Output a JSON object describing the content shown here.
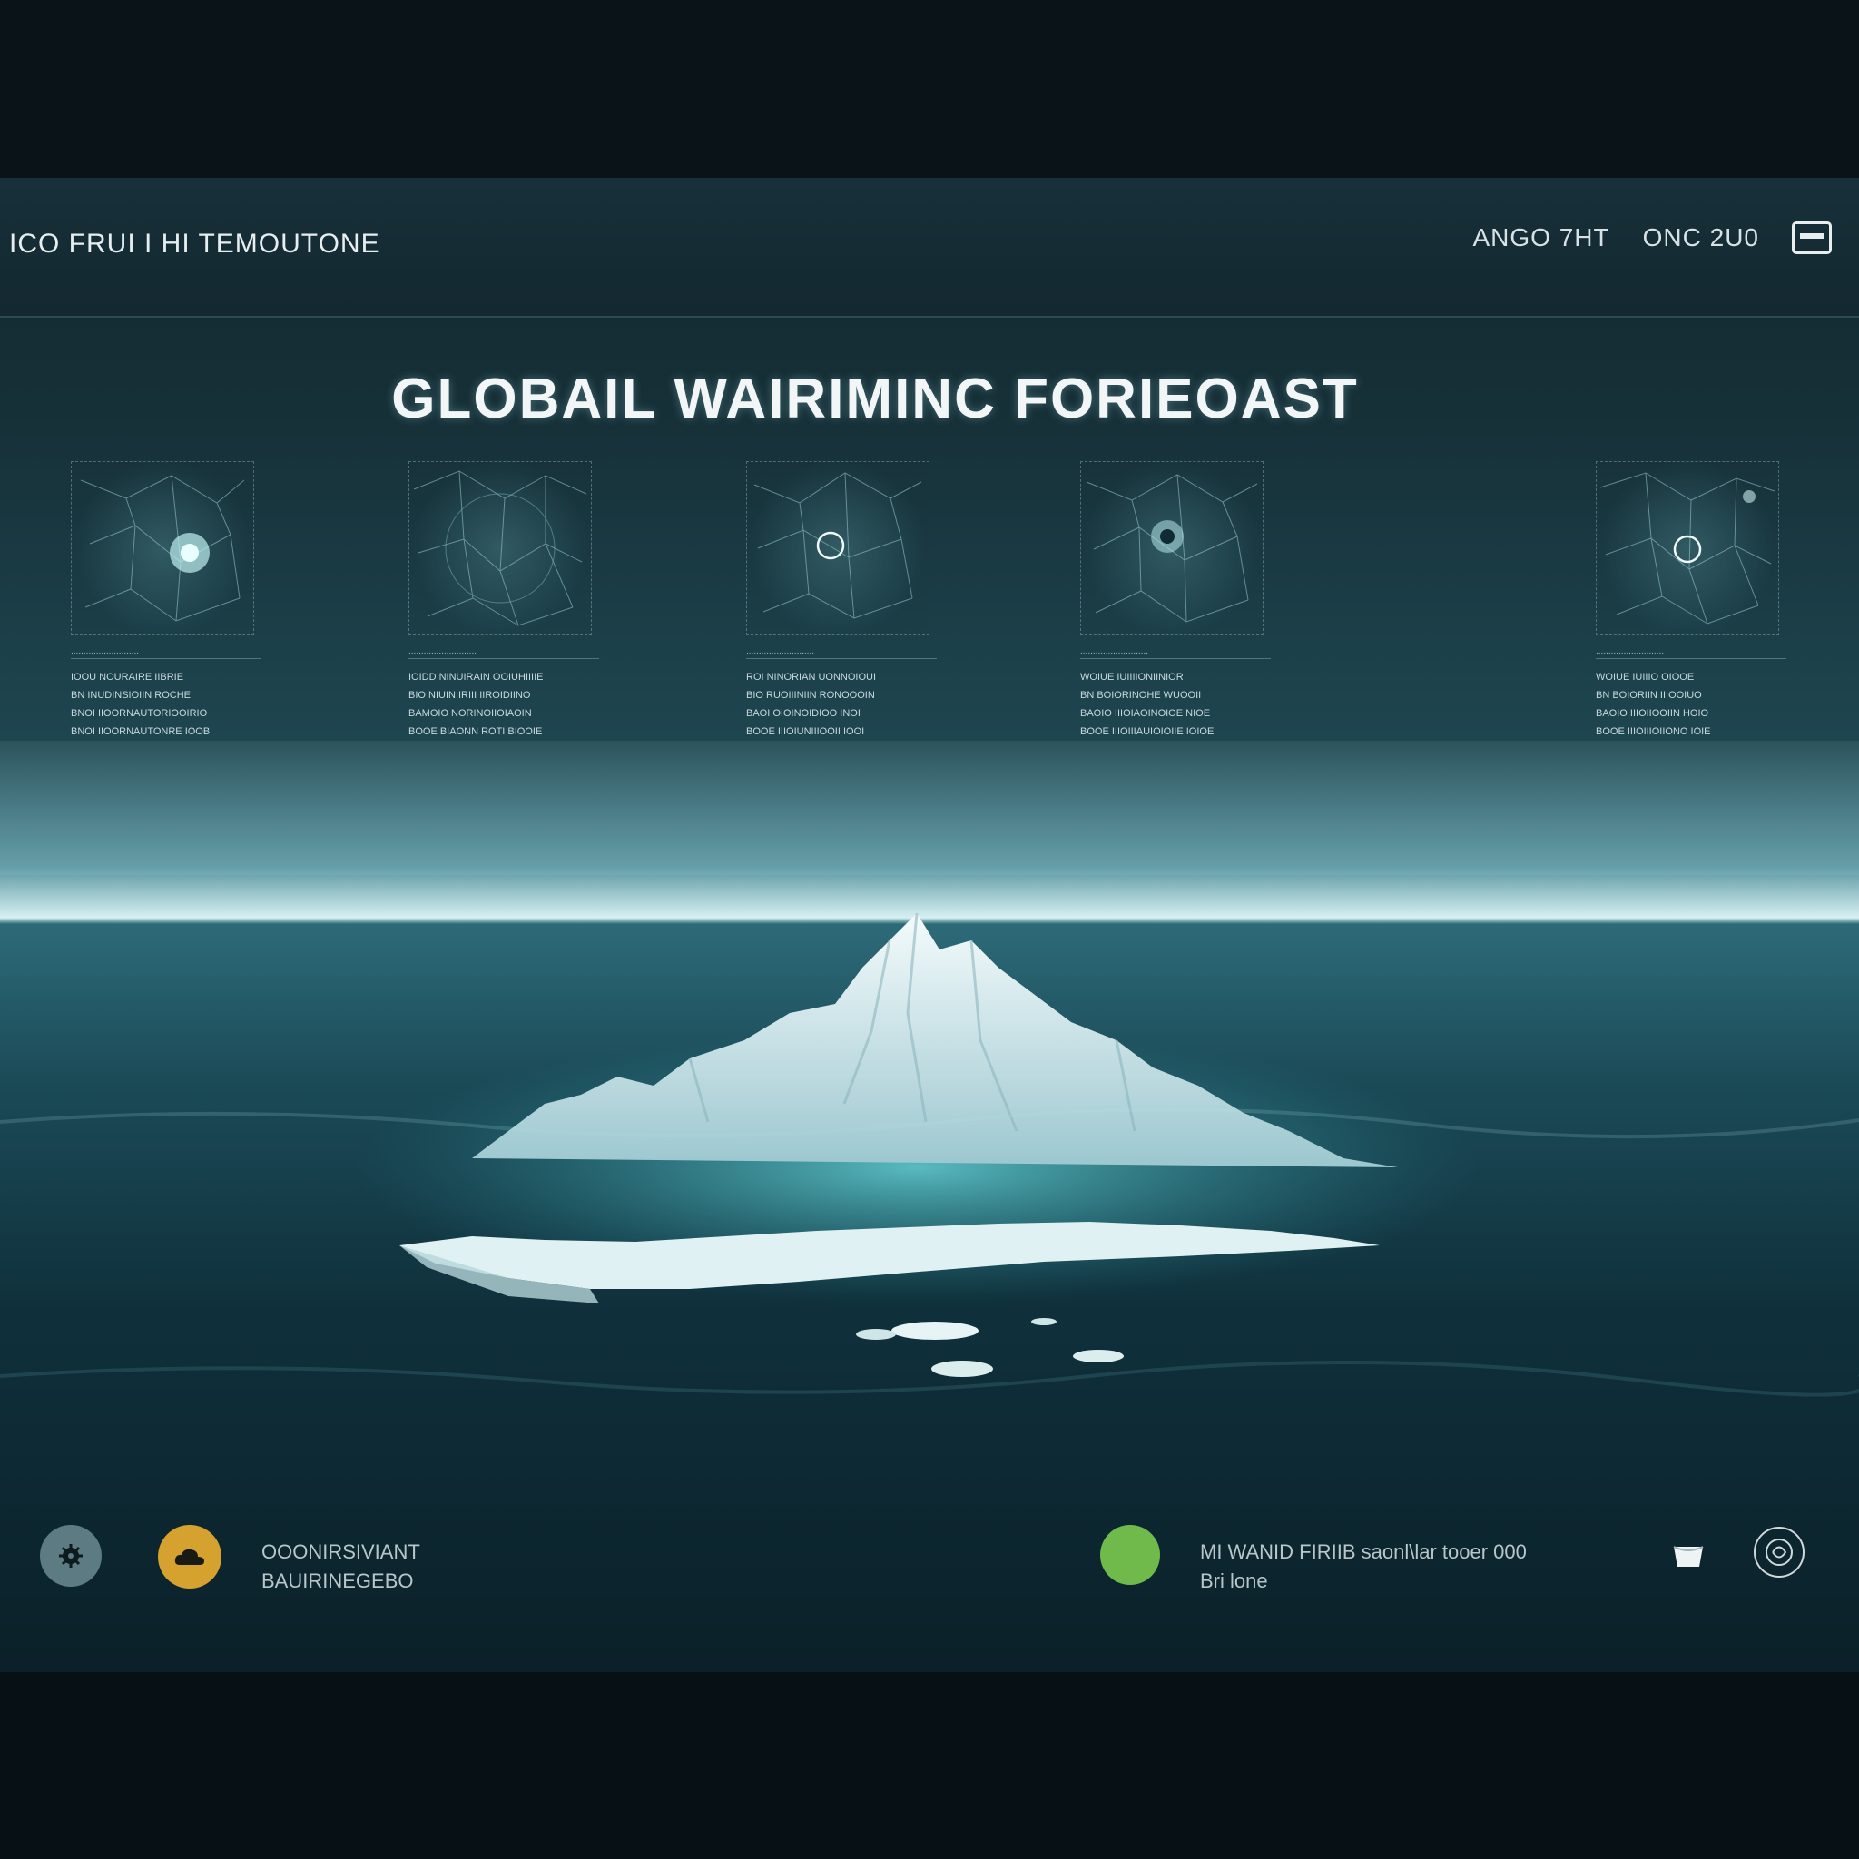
{
  "header": {
    "app_title": "ICO FRUI I HI TEMOUTONE",
    "meta_left": "ANGO 7HT",
    "meta_right": "ONC 2U0"
  },
  "hero": {
    "title": "GLOBAIL WAIRIMINC FORIEOAST"
  },
  "panels": [
    {
      "caption": "...........................",
      "lines": [
        "IOOU NOURAIRE IIBRIE",
        "BN INUDINSIOIIN ROCHE",
        "BNOI IIOORNAUTORIOOIRIO",
        "BNOI IIOORNAUTONRE IOOB"
      ]
    },
    {
      "caption": "...........................",
      "lines": [
        "IOIDD NINUIRAIN OOIUHIIIIE",
        "BIO NIUINIIRIII IIROIDIINO",
        "BAMOIO NORINOIIOIAOIN",
        "BOOE BIAONN ROTI BIOOIE"
      ]
    },
    {
      "caption": "...........................",
      "lines": [
        "ROI NINORIAN UONNOIOUI",
        "BIO RUOIIINIIN RONOOOIN",
        "BAOI OIOINOIDIOO INOI",
        "BOOE IIIOIUNIIIOOII IOOI"
      ]
    },
    {
      "caption": "...........................",
      "lines": [
        "WOIUE IUIIIIONIINIOR",
        "BN BOIORINOHE WUOOII",
        "BAOIO IIIOIAOINOIOE NIOE",
        "BOOE IIIOIIIAUIOIOIIE IOIOE"
      ]
    },
    {
      "caption": "...........................",
      "lines": [
        "WOIUE IUIIIO OIOOE",
        "BN BOIORIIN IIIOOIUO",
        "BAOIO IIIOIIOOIIN HOIO",
        "BOOE IIIOIIIOIIONO IOIE"
      ]
    }
  ],
  "footer": {
    "left_line1": "OOONIRSIVIANT",
    "left_line2": "BAUIRINEGEBO",
    "right_line1": "MI WANID FIRIIB saonl\\lar tooer 000",
    "right_line2": "Bri lone"
  },
  "icons": {
    "settings": "gear-icon",
    "weather": "cloud-icon",
    "status": "status-dot-icon",
    "cup": "cup-icon",
    "profile": "globe-icon",
    "window": "window-icon"
  },
  "colors": {
    "status_green": "#6fba4b",
    "accent_gold": "#d5a12f",
    "panel_grey": "#5d7b83"
  }
}
